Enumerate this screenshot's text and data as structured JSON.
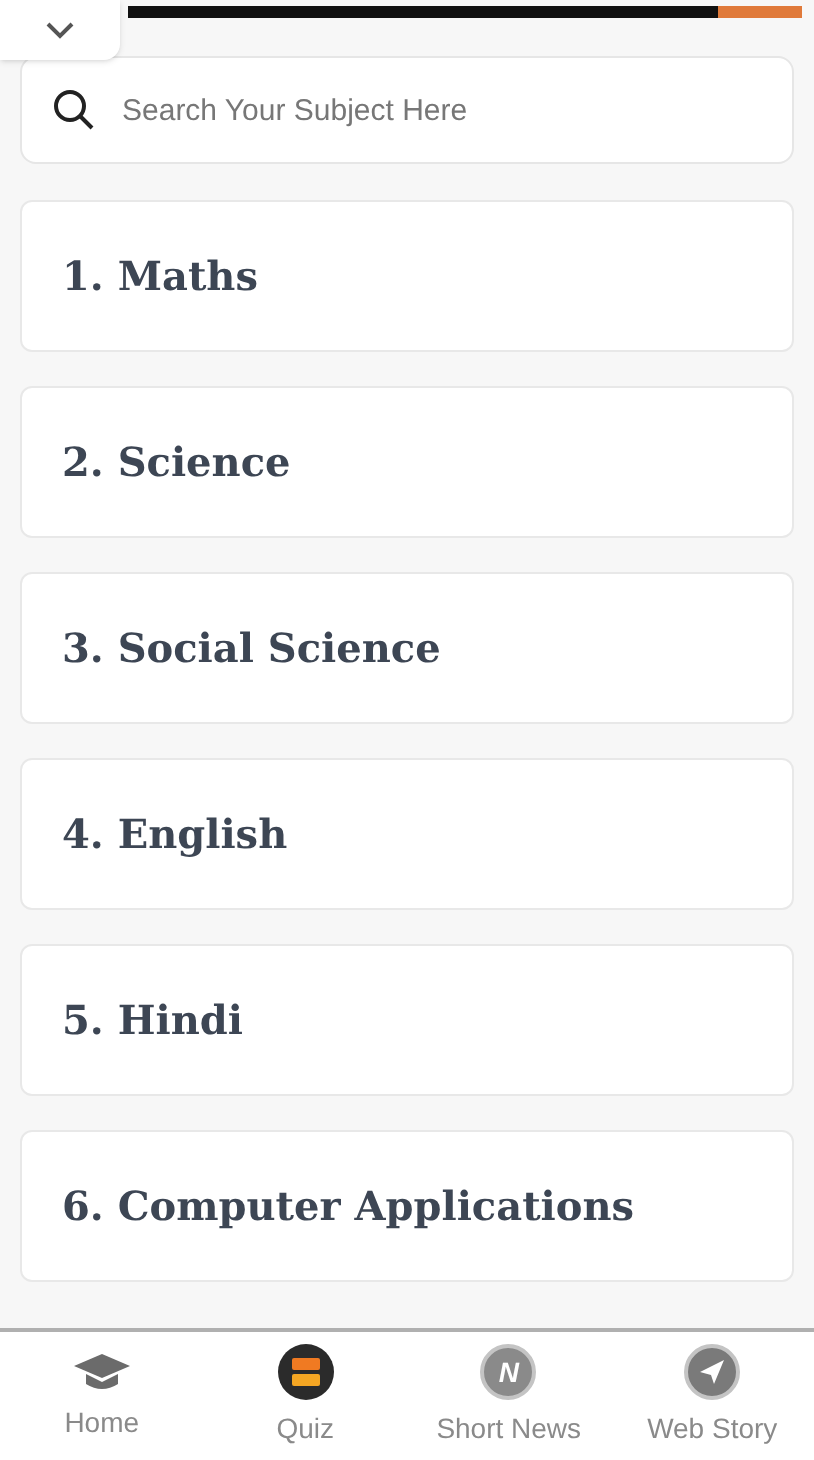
{
  "search": {
    "placeholder": "Search Your Subject Here"
  },
  "subjects": [
    {
      "label": "1. Maths"
    },
    {
      "label": "2. Science"
    },
    {
      "label": "3. Social Science"
    },
    {
      "label": "4. English"
    },
    {
      "label": "5. Hindi"
    },
    {
      "label": "6. Computer Applications"
    }
  ],
  "bottom_nav": [
    {
      "label": "Home",
      "kind": "home"
    },
    {
      "label": "Quiz",
      "kind": "quiz"
    },
    {
      "label": "Short News",
      "kind": "news",
      "icon_text": "N"
    },
    {
      "label": "Web Story",
      "kind": "story"
    }
  ]
}
